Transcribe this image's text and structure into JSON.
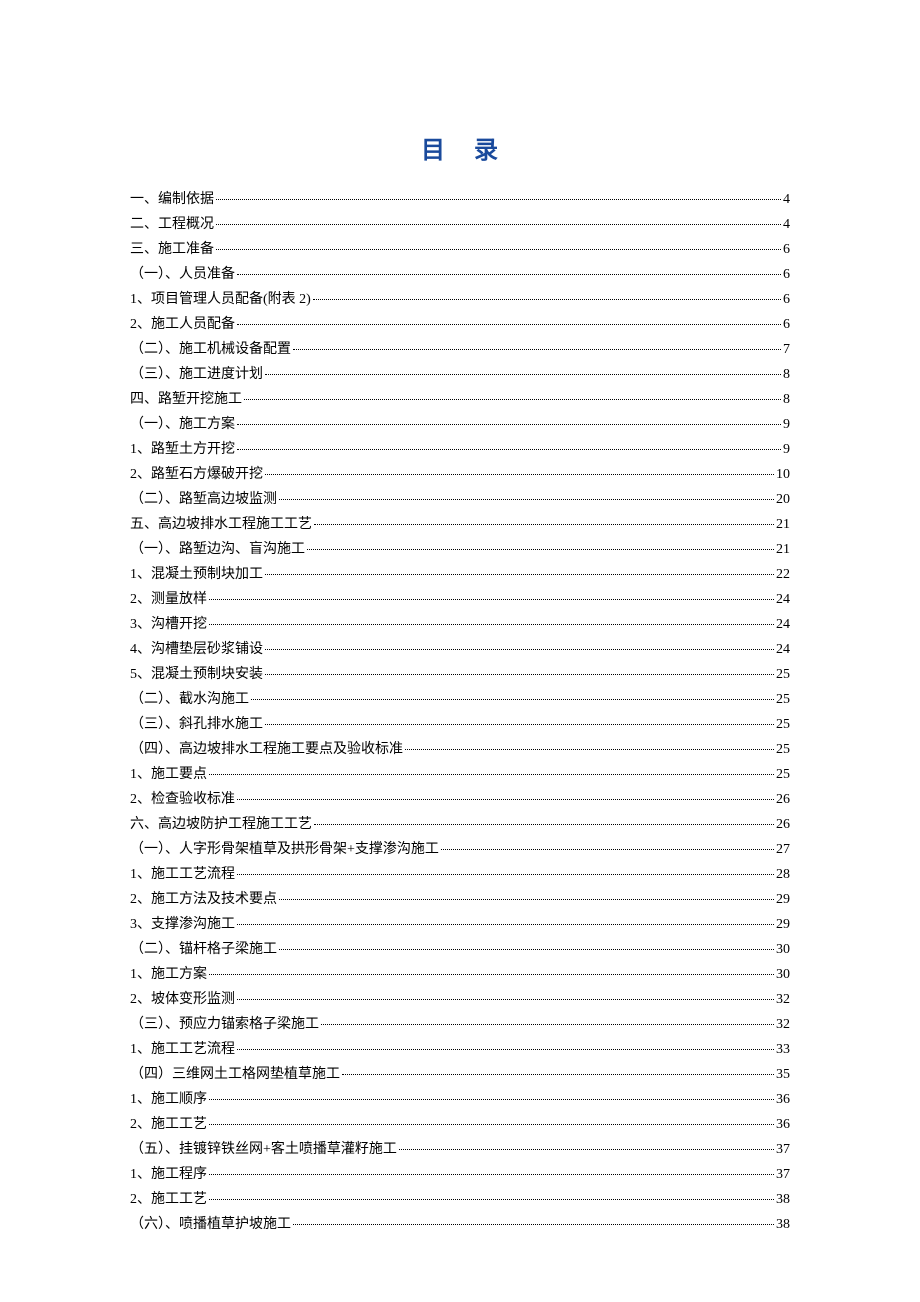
{
  "title_left": "目",
  "title_right": "录",
  "toc": [
    {
      "text": "一、编制依据",
      "page": "4"
    },
    {
      "text": "二、工程概况",
      "page": "4"
    },
    {
      "text": "三、施工准备",
      "page": "6"
    },
    {
      "text": "（一）、人员准备",
      "page": "6"
    },
    {
      "text": "1、项目管理人员配备(附表 2)",
      "page": "6"
    },
    {
      "text": "2、施工人员配备",
      "page": "6"
    },
    {
      "text": "（二）、施工机械设备配置",
      "page": "7"
    },
    {
      "text": "（三）、施工进度计划",
      "page": "8"
    },
    {
      "text": "四、路堑开挖施工",
      "page": "8"
    },
    {
      "text": "（一）、施工方案",
      "page": "9"
    },
    {
      "text": "1、路堑土方开挖",
      "page": "9"
    },
    {
      "text": "2、路堑石方爆破开挖",
      "page": "10"
    },
    {
      "text": "（二）、路堑高边坡监测",
      "page": "20"
    },
    {
      "text": "五、高边坡排水工程施工工艺",
      "page": "21"
    },
    {
      "text": "（一）、路堑边沟、盲沟施工",
      "page": "21"
    },
    {
      "text": "1、混凝土预制块加工",
      "page": "22"
    },
    {
      "text": "2、测量放样",
      "page": "24"
    },
    {
      "text": "3、沟槽开挖",
      "page": "24"
    },
    {
      "text": "4、沟槽垫层砂浆铺设",
      "page": "24"
    },
    {
      "text": "5、混凝土预制块安装",
      "page": "25"
    },
    {
      "text": "（二）、截水沟施工",
      "page": "25"
    },
    {
      "text": "（三）、斜孔排水施工",
      "page": "25"
    },
    {
      "text": "（四）、高边坡排水工程施工要点及验收标准",
      "page": "25"
    },
    {
      "text": "1、施工要点",
      "page": "25"
    },
    {
      "text": "2、检查验收标准",
      "page": "26"
    },
    {
      "text": "六、高边坡防护工程施工工艺",
      "page": "26"
    },
    {
      "text": "（一）、人字形骨架植草及拱形骨架+支撑渗沟施工",
      "page": "27"
    },
    {
      "text": "1、施工工艺流程",
      "page": "28"
    },
    {
      "text": "2、施工方法及技术要点",
      "page": "29"
    },
    {
      "text": "3、支撑渗沟施工",
      "page": "29"
    },
    {
      "text": "（二）、锚杆格子梁施工",
      "page": "30"
    },
    {
      "text": "1、施工方案",
      "page": "30"
    },
    {
      "text": "2、坡体变形监测",
      "page": "32"
    },
    {
      "text": "（三）、预应力锚索格子梁施工",
      "page": "32"
    },
    {
      "text": "1、施工工艺流程",
      "page": "33"
    },
    {
      "text": "（四）三维网土工格网垫植草施工",
      "page": "35"
    },
    {
      "text": "1、施工顺序",
      "page": "36"
    },
    {
      "text": "2、施工工艺",
      "page": "36"
    },
    {
      "text": "（五）、挂镀锌铁丝网+客土喷播草灌籽施工",
      "page": "37"
    },
    {
      "text": "1、施工程序",
      "page": "37"
    },
    {
      "text": "2、施工工艺",
      "page": "38"
    },
    {
      "text": "（六）、喷播植草护坡施工",
      "page": "38"
    }
  ]
}
